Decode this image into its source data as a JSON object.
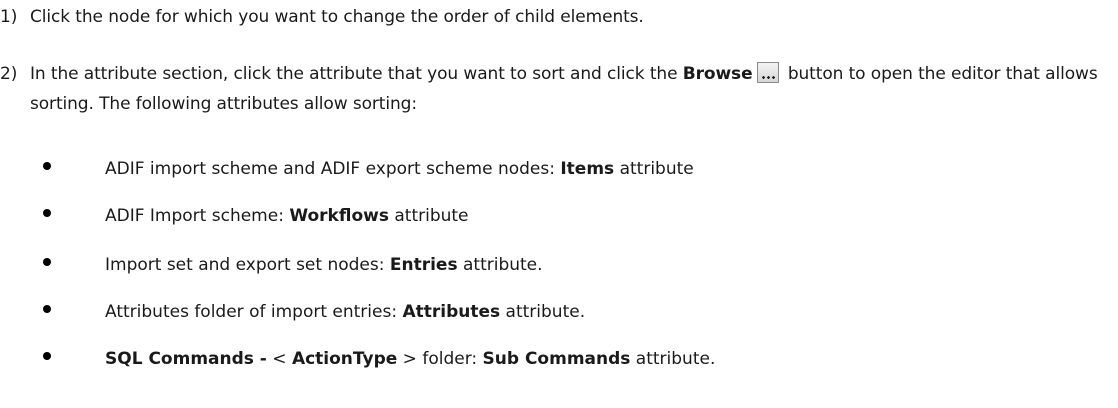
{
  "steps": [
    {
      "number": "1)",
      "text": "Click the node for which you want to change the order of child elements."
    },
    {
      "number": "2)",
      "text_before": "In the attribute section, click the attribute that you want to sort and click the ",
      "bold": "Browse",
      "icon": "browse-icon",
      "text_after": " button to open the editor that allows sorting. The following attributes allow sorting:"
    }
  ],
  "bullets": [
    {
      "pre": "ADIF import scheme and ADIF export scheme nodes: ",
      "bold": "Items",
      "post": " attribute"
    },
    {
      "pre": "ADIF Import scheme: ",
      "bold": "Workflows",
      "post": " attribute"
    },
    {
      "pre": "Import set and export set nodes: ",
      "bold": "Entries",
      "post": " attribute."
    },
    {
      "pre": "Attributes folder of import entries: ",
      "bold": "Attributes",
      "post": " attribute."
    },
    {
      "bold_a": "SQL Commands -",
      "lt": " < ",
      "bold_b": "ActionType",
      "gt": " > folder: ",
      "bold_c": "Sub Commands",
      "post": " attribute."
    }
  ]
}
